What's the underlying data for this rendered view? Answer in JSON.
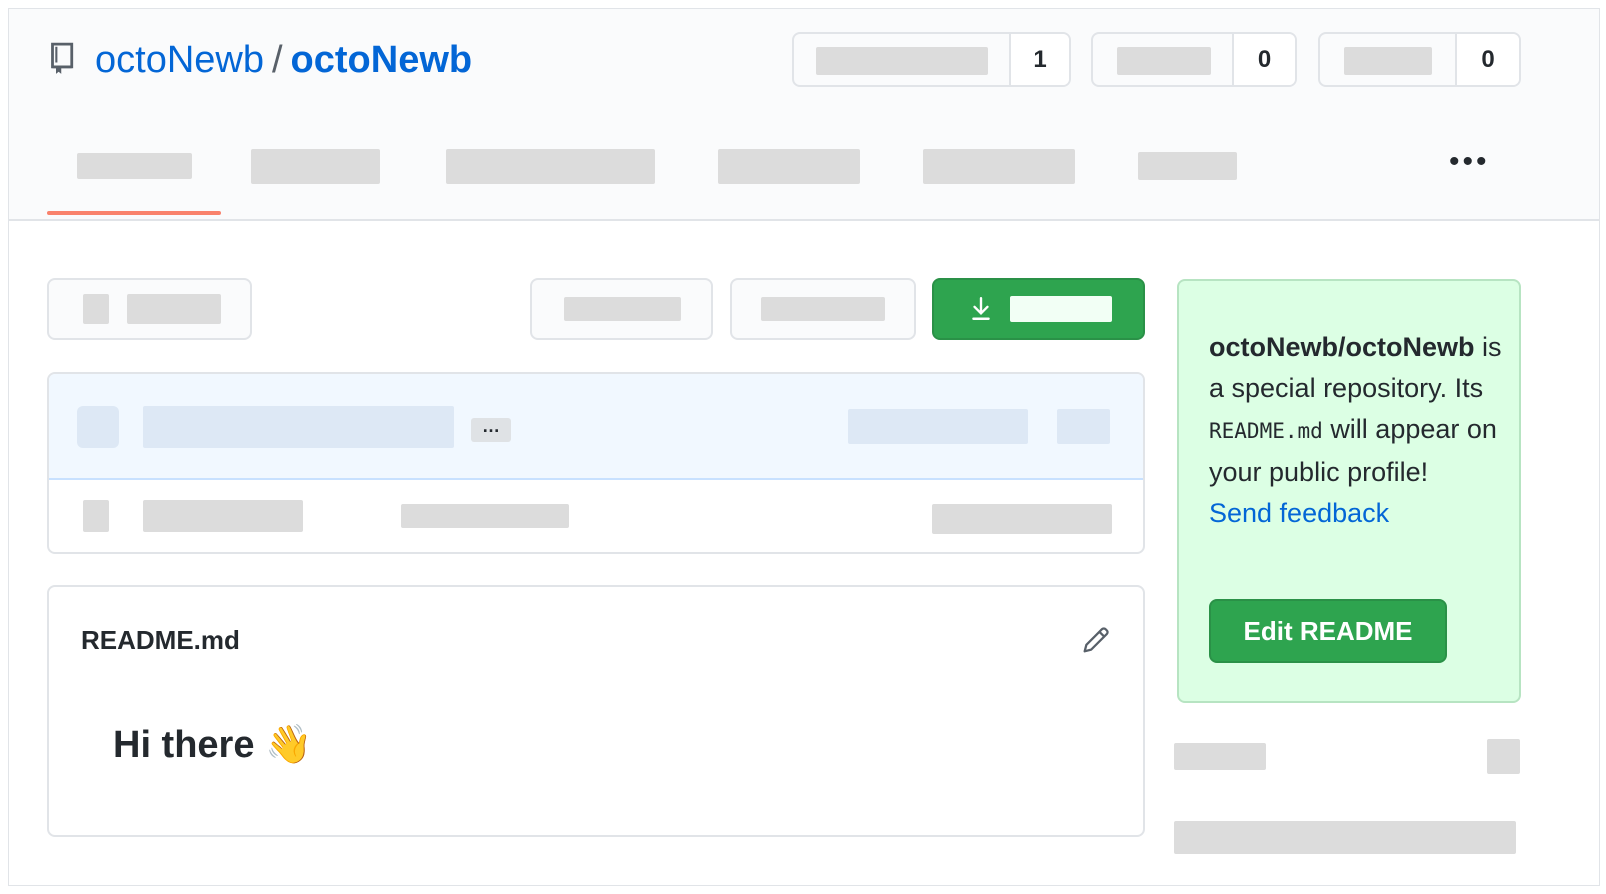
{
  "repo": {
    "owner": "octoNewb",
    "separator": "/",
    "name": "octoNewb",
    "icon": "repo-icon"
  },
  "counters": [
    {
      "count": "1"
    },
    {
      "count": "0"
    },
    {
      "count": "0"
    }
  ],
  "nav": {
    "more_label": "•••"
  },
  "filelist": {
    "ellipsis": "…"
  },
  "readme": {
    "filename": "README.md",
    "heading": "Hi there 👋",
    "edit_icon": "pencil-icon"
  },
  "sidebar": {
    "repo_full_name": "octoNewb/octoNewb",
    "text_1": "is a special repository. Its",
    "code": "README.md",
    "text_2": "will appear on your public profile!",
    "feedback_link": "Send feedback",
    "edit_button": "Edit README"
  },
  "colors": {
    "link": "#0366d6",
    "primary_green": "#2ea44f",
    "tab_underline": "#f9826c",
    "sidebar_bg": "#dcffe4"
  }
}
